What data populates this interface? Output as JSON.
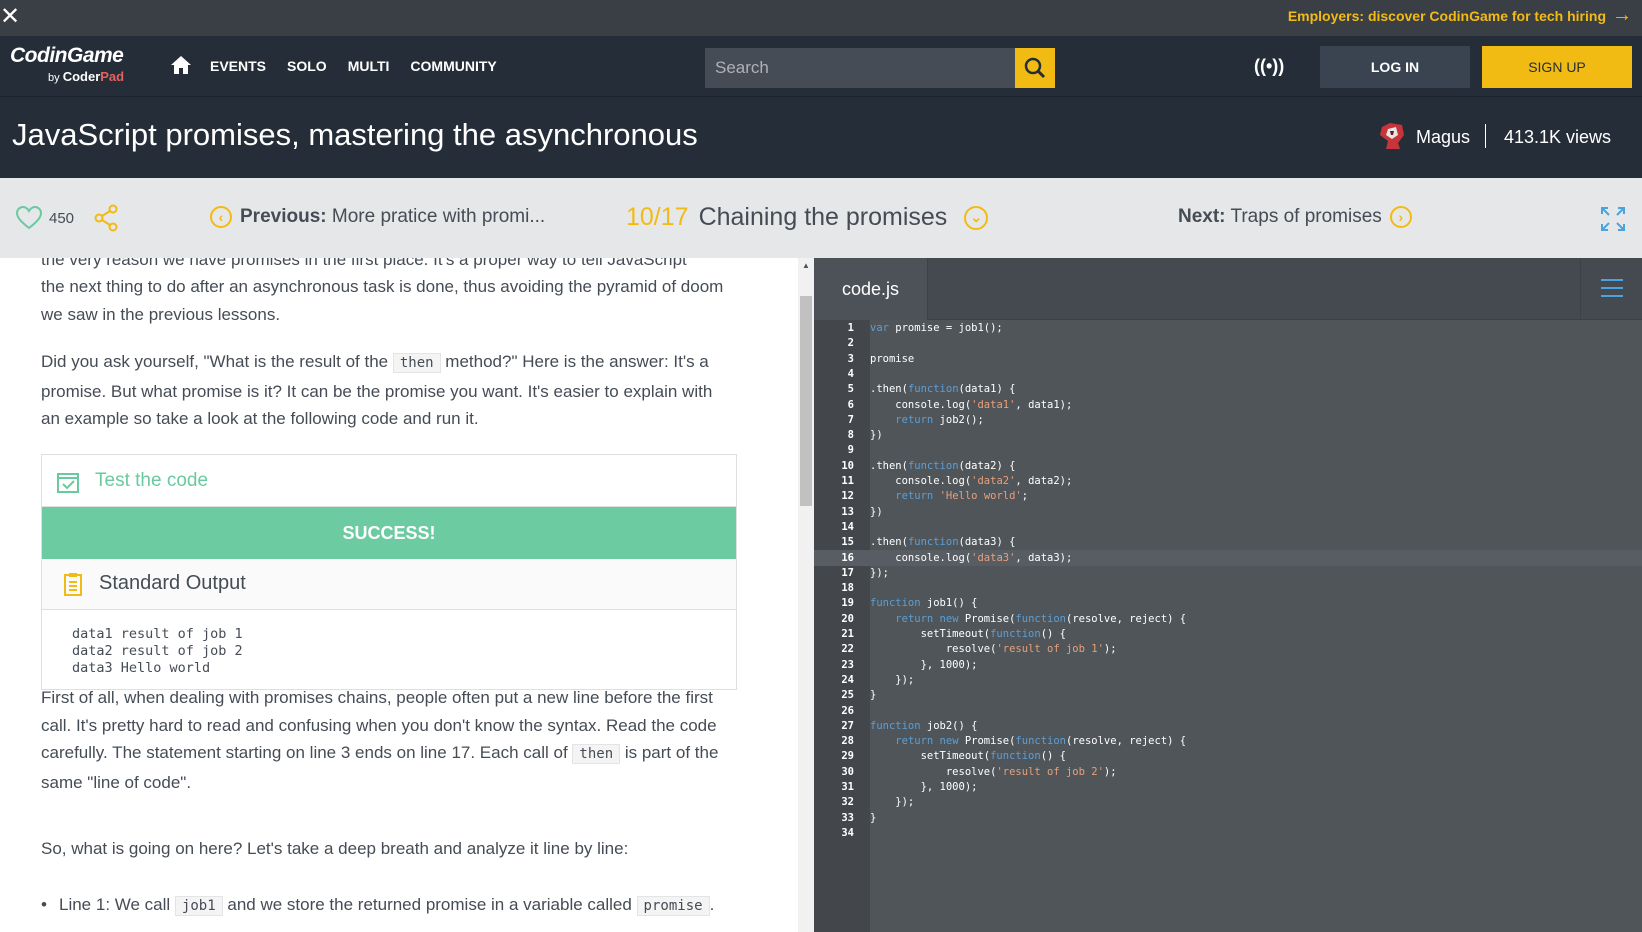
{
  "promo": {
    "close": "✕",
    "text": "Employers: discover CodinGame for tech hiring",
    "arrow": "→"
  },
  "nav": {
    "logo_main": "CodinGame",
    "logo_by": "by",
    "logo_coder": "Coder",
    "logo_pad": "Pad",
    "links": [
      "EVENTS",
      "SOLO",
      "MULTI",
      "COMMUNITY"
    ],
    "search_placeholder": "Search",
    "login": "LOG IN",
    "signup": "SIGN UP",
    "live_icon": "((•))"
  },
  "title": {
    "heading": "JavaScript promises, mastering the asynchronous",
    "author": "Magus",
    "views": "413.1K views"
  },
  "lesson": {
    "likes": "450",
    "prev_label": "Previous:",
    "prev_title": " More pratice with promi...",
    "index": "10/17",
    "chapter": "Chaining the promises",
    "next_label": "Next:",
    "next_title": " Traps of promises"
  },
  "content": {
    "p1_line0": "the very reason we have promises in the first place. It's a proper way to tell JavaScript",
    "p1_rest": "the next thing to do after an asynchronous task is done, thus avoiding the pyramid of doom we saw in the previous lessons.",
    "p2_a": "Did you ask yourself, \"What is the result of the ",
    "p2_code": "then",
    "p2_b": " method?\" Here is the answer: It's a promise. But what promise is it? It can be the promise you want. It's easier to explain with an example so take a look at the following code and run it.",
    "test_label": "Test the code",
    "success": "SUCCESS!",
    "stdout_label": "Standard Output",
    "stdout": "data1 result of job 1\ndata2 result of job 2\ndata3 Hello world",
    "p3_a": "First of all, when dealing with promises chains, people often put a new line before the first call. It's pretty hard to read and confusing when you don't know the syntax. Read the code carefully. The statement starting on line 3 ends on line 17. Each call of ",
    "p3_code": "then",
    "p3_b": " is part of the same \"line of code\".",
    "p4": "So, what is going on here? Let's take a deep breath and analyze it line by line:",
    "li1_a": "Line 1: We call ",
    "li1_code": "job1",
    "li1_b": " and we store the returned promise in a variable called ",
    "li1_code2": "promise",
    "li1_c": "."
  },
  "editor": {
    "tab": "code.js",
    "code": [
      [
        [
          "kw",
          "var"
        ],
        [
          "pl",
          " promise = job1();"
        ]
      ],
      [],
      [
        [
          "pl",
          "promise"
        ]
      ],
      [],
      [
        [
          "pl",
          ".then("
        ],
        [
          "kw",
          "function"
        ],
        [
          "pl",
          "(data1) {"
        ]
      ],
      [
        [
          "pl",
          "    console.log("
        ],
        [
          "str",
          "'data1'"
        ],
        [
          "pl",
          ", data1);"
        ]
      ],
      [
        [
          "pl",
          "    "
        ],
        [
          "kw",
          "return"
        ],
        [
          "pl",
          " job2();"
        ]
      ],
      [
        [
          "pl",
          "})"
        ]
      ],
      [],
      [
        [
          "pl",
          ".then("
        ],
        [
          "kw",
          "function"
        ],
        [
          "pl",
          "(data2) {"
        ]
      ],
      [
        [
          "pl",
          "    console.log("
        ],
        [
          "str",
          "'data2'"
        ],
        [
          "pl",
          ", data2);"
        ]
      ],
      [
        [
          "pl",
          "    "
        ],
        [
          "kw",
          "return"
        ],
        [
          "pl",
          " "
        ],
        [
          "str",
          "'Hello world'"
        ],
        [
          "pl",
          ";"
        ]
      ],
      [
        [
          "pl",
          "})"
        ]
      ],
      [],
      [
        [
          "pl",
          ".then("
        ],
        [
          "kw",
          "function"
        ],
        [
          "pl",
          "(data3) {"
        ]
      ],
      [
        [
          "pl",
          "    console.log("
        ],
        [
          "str",
          "'data3'"
        ],
        [
          "pl",
          ", data3);"
        ]
      ],
      [
        [
          "pl",
          "});"
        ]
      ],
      [],
      [
        [
          "kw",
          "function"
        ],
        [
          "pl",
          " job1() {"
        ]
      ],
      [
        [
          "pl",
          "    "
        ],
        [
          "kw",
          "return new"
        ],
        [
          "pl",
          " Promise("
        ],
        [
          "kw",
          "function"
        ],
        [
          "pl",
          "(resolve, reject) {"
        ]
      ],
      [
        [
          "pl",
          "        setTimeout("
        ],
        [
          "kw",
          "function"
        ],
        [
          "pl",
          "() {"
        ]
      ],
      [
        [
          "pl",
          "            resolve("
        ],
        [
          "str",
          "'result of job 1'"
        ],
        [
          "pl",
          ");"
        ]
      ],
      [
        [
          "pl",
          "        }, 1000);"
        ]
      ],
      [
        [
          "pl",
          "    });"
        ]
      ],
      [
        [
          "pl",
          "}"
        ]
      ],
      [],
      [
        [
          "kw",
          "function"
        ],
        [
          "pl",
          " job2() {"
        ]
      ],
      [
        [
          "pl",
          "    "
        ],
        [
          "kw",
          "return new"
        ],
        [
          "pl",
          " Promise("
        ],
        [
          "kw",
          "function"
        ],
        [
          "pl",
          "(resolve, reject) {"
        ]
      ],
      [
        [
          "pl",
          "        setTimeout("
        ],
        [
          "kw",
          "function"
        ],
        [
          "pl",
          "() {"
        ]
      ],
      [
        [
          "pl",
          "            resolve("
        ],
        [
          "str",
          "'result of job 2'"
        ],
        [
          "pl",
          ");"
        ]
      ],
      [
        [
          "pl",
          "        }, 1000);"
        ]
      ],
      [
        [
          "pl",
          "    });"
        ]
      ],
      [
        [
          "pl",
          "}"
        ]
      ],
      []
    ],
    "active_line": 16
  }
}
